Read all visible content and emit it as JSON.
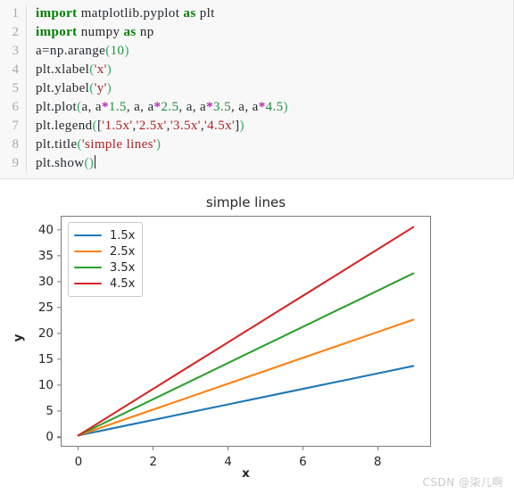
{
  "editor": {
    "lines": [
      {
        "n": "1",
        "tokens": [
          {
            "t": "import",
            "c": "kw"
          },
          {
            "t": " matplotlib.pyplot ",
            "c": "plain"
          },
          {
            "t": "as",
            "c": "kw"
          },
          {
            "t": " plt",
            "c": "plain"
          }
        ]
      },
      {
        "n": "2",
        "tokens": [
          {
            "t": "import",
            "c": "kw"
          },
          {
            "t": " numpy ",
            "c": "plain"
          },
          {
            "t": "as",
            "c": "kw"
          },
          {
            "t": " np",
            "c": "plain"
          }
        ]
      },
      {
        "n": "3",
        "tokens": [
          {
            "t": "a=np.arange",
            "c": "plain"
          },
          {
            "t": "(",
            "c": "paren"
          },
          {
            "t": "10",
            "c": "num"
          },
          {
            "t": ")",
            "c": "paren"
          }
        ]
      },
      {
        "n": "4",
        "tokens": [
          {
            "t": "plt.xlabel",
            "c": "plain"
          },
          {
            "t": "(",
            "c": "paren"
          },
          {
            "t": "'x'",
            "c": "str"
          },
          {
            "t": ")",
            "c": "paren"
          }
        ]
      },
      {
        "n": "5",
        "tokens": [
          {
            "t": "plt.ylabel",
            "c": "plain"
          },
          {
            "t": "(",
            "c": "paren"
          },
          {
            "t": "'y'",
            "c": "str"
          },
          {
            "t": ")",
            "c": "paren"
          }
        ]
      },
      {
        "n": "6",
        "tokens": [
          {
            "t": "plt.plot",
            "c": "plain"
          },
          {
            "t": "(",
            "c": "paren"
          },
          {
            "t": "a, a",
            "c": "plain"
          },
          {
            "t": "*",
            "c": "op"
          },
          {
            "t": "1.5",
            "c": "num"
          },
          {
            "t": ", a, a",
            "c": "plain"
          },
          {
            "t": "*",
            "c": "op"
          },
          {
            "t": "2.5",
            "c": "num"
          },
          {
            "t": ", a, a",
            "c": "plain"
          },
          {
            "t": "*",
            "c": "op"
          },
          {
            "t": "3.5",
            "c": "num"
          },
          {
            "t": ", a, a",
            "c": "plain"
          },
          {
            "t": "*",
            "c": "op"
          },
          {
            "t": "4.5",
            "c": "num"
          },
          {
            "t": ")",
            "c": "paren"
          }
        ]
      },
      {
        "n": "7",
        "tokens": [
          {
            "t": "plt.legend",
            "c": "plain"
          },
          {
            "t": "(",
            "c": "paren"
          },
          {
            "t": "[",
            "c": "plain"
          },
          {
            "t": "'1.5x'",
            "c": "str"
          },
          {
            "t": ",",
            "c": "plain"
          },
          {
            "t": "'2.5x'",
            "c": "str"
          },
          {
            "t": ",",
            "c": "plain"
          },
          {
            "t": "'3.5x'",
            "c": "str"
          },
          {
            "t": ",",
            "c": "plain"
          },
          {
            "t": "'4.5x'",
            "c": "str"
          },
          {
            "t": "]",
            "c": "plain"
          },
          {
            "t": ")",
            "c": "paren"
          }
        ]
      },
      {
        "n": "8",
        "tokens": [
          {
            "t": "plt.title",
            "c": "plain"
          },
          {
            "t": "(",
            "c": "paren"
          },
          {
            "t": "'simple lines'",
            "c": "str"
          },
          {
            "t": ")",
            "c": "paren"
          }
        ]
      },
      {
        "n": "9",
        "tokens": [
          {
            "t": "plt.show",
            "c": "plain"
          },
          {
            "t": "(",
            "c": "paren"
          },
          {
            "t": ")",
            "c": "paren"
          }
        ],
        "caret": true
      }
    ]
  },
  "watermark": "CSDN @柒儿啊",
  "chart_data": {
    "type": "line",
    "title": "simple lines",
    "xlabel": "x",
    "ylabel": "y",
    "x": [
      0,
      1,
      2,
      3,
      4,
      5,
      6,
      7,
      8,
      9
    ],
    "series": [
      {
        "name": "1.5x",
        "slope": 1.5,
        "color": "#1f77b4",
        "values": [
          0,
          1.5,
          3,
          4.5,
          6,
          7.5,
          9,
          10.5,
          12,
          13.5
        ]
      },
      {
        "name": "2.5x",
        "slope": 2.5,
        "color": "#ff7f0e",
        "values": [
          0,
          2.5,
          5,
          7.5,
          10,
          12.5,
          15,
          17.5,
          20,
          22.5
        ]
      },
      {
        "name": "3.5x",
        "slope": 3.5,
        "color": "#2ca02c",
        "values": [
          0,
          3.5,
          7,
          10.5,
          14,
          17.5,
          21,
          24.5,
          28,
          31.5
        ]
      },
      {
        "name": "4.5x",
        "slope": 4.5,
        "color": "#d62728",
        "values": [
          0,
          4.5,
          9,
          13.5,
          18,
          22.5,
          27,
          31.5,
          36,
          40.5
        ]
      }
    ],
    "xlim": [
      -0.45,
      9.45
    ],
    "ylim": [
      -2.02,
      42.52
    ],
    "xticks": [
      0,
      2,
      4,
      6,
      8
    ],
    "yticks": [
      0,
      5,
      10,
      15,
      20,
      25,
      30,
      35,
      40
    ],
    "grid": false,
    "legend_position": "upper left"
  }
}
